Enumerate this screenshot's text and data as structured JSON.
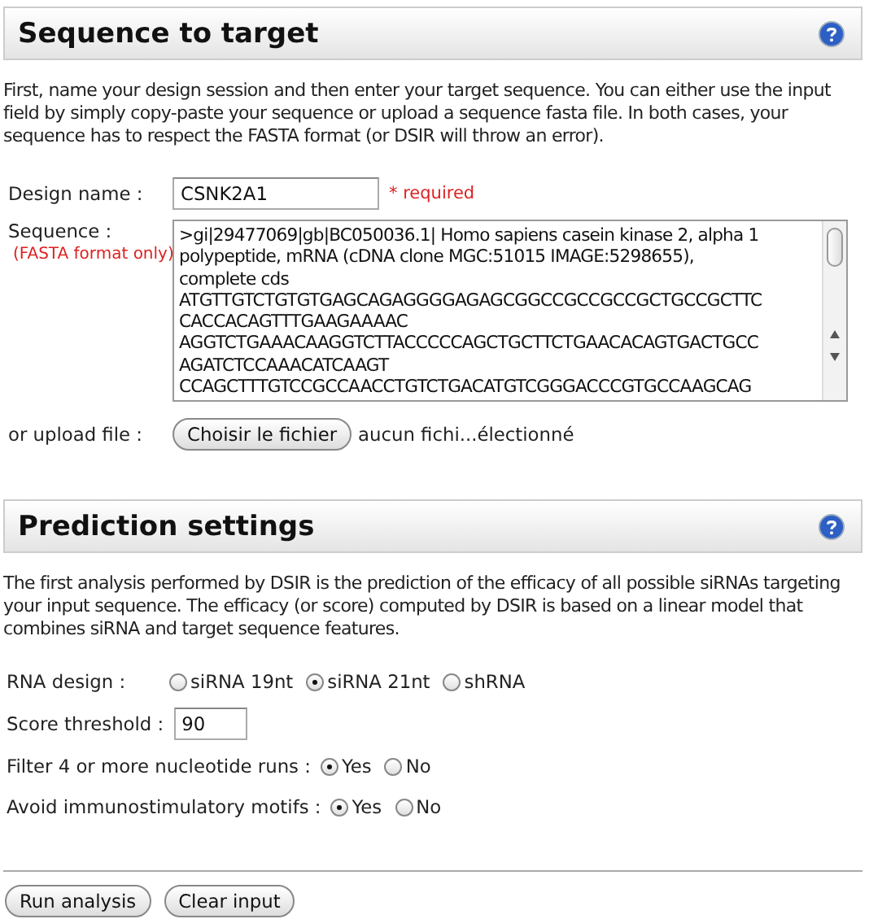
{
  "sections": [
    {
      "title": "Sequence to target",
      "description": "First, name your design session and then enter your target sequence. You can either use the input field by simply copy-paste your sequence or upload a sequence fasta file. In both cases, your sequence has to respect the FASTA format (or DSIR will throw an error)."
    },
    {
      "title": "Prediction settings",
      "description": "The first analysis performed by DSIR is the prediction of the efficacy of all possible siRNAs targeting your input sequence. The efficacy (or score) computed by DSIR is based on a linear model that combines siRNA and target sequence features."
    }
  ],
  "design_name": {
    "label": "Design name :",
    "value": "CSNK2A1",
    "note": "* required"
  },
  "sequence": {
    "label": "Sequence :",
    "hint": "(FASTA format only)",
    "value": ">gi|29477069|gb|BC050036.1| Homo sapiens casein kinase 2, alpha 1\npolypeptide, mRNA (cDNA clone MGC:51015 IMAGE:5298655),\ncomplete cds\nATGTTGTCTGTGTGAGCAGAGGGGAGAGCGGCCGCCGCCGCTGCCGCTTC\nCACCACAGTTTGAAGAAAAC\nAGGTCTGAAACAAGGTCTTACCCCCAGCTGCTTCTGAACACAGTGACTGCC\nAGATCTCCAAACATCAAGT\nCCAGCTTTGTCCGCCAACCTGTCTGACATGTCGGGACCCGTGCCAAGCAG"
  },
  "upload": {
    "label": "or upload file :",
    "button": "Choisir le fichier",
    "status": "aucun fichi...électionné"
  },
  "settings": [
    {
      "kind": "radio",
      "label": "RNA design :",
      "options": [
        {
          "label": "siRNA 19nt",
          "selected": false
        },
        {
          "label": "siRNA 21nt",
          "selected": true
        },
        {
          "label": "shRNA",
          "selected": false
        }
      ]
    },
    {
      "kind": "input",
      "label": "Score threshold :",
      "value": "90"
    },
    {
      "kind": "radio",
      "label": "Filter 4 or more nucleotide runs :",
      "options": [
        {
          "label": "Yes",
          "selected": true
        },
        {
          "label": "No",
          "selected": false
        }
      ]
    },
    {
      "kind": "radio",
      "label": "Avoid immunostimulatory motifs :",
      "options": [
        {
          "label": "Yes",
          "selected": true
        },
        {
          "label": "No",
          "selected": false
        }
      ]
    }
  ],
  "buttons": [
    "Run analysis",
    "Clear input"
  ]
}
